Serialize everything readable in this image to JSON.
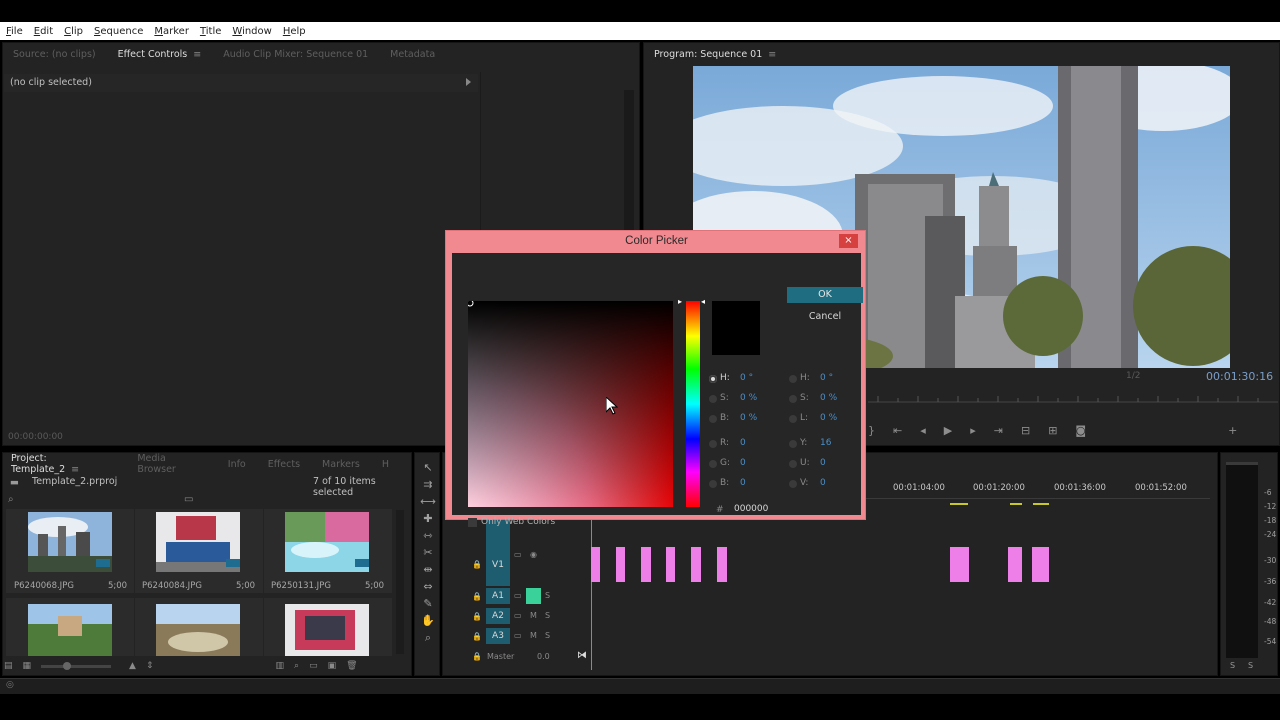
{
  "menu": [
    "File",
    "Edit",
    "Clip",
    "Sequence",
    "Marker",
    "Title",
    "Window",
    "Help"
  ],
  "effect_panel": {
    "tabs": [
      "Source: (no clips)",
      "Effect Controls",
      "Audio Clip Mixer: Sequence 01",
      "Metadata"
    ],
    "no_clip": "(no clip selected)",
    "timecode": "00:00:00:00"
  },
  "program": {
    "title": "Program: Sequence 01",
    "zoom": "1/2",
    "timecode": "00:01:30:16"
  },
  "project": {
    "tabs": [
      "Project: Template_2",
      "Media Browser",
      "Info",
      "Effects",
      "Markers",
      "H"
    ],
    "file": "Template_2.prproj",
    "selection": "7 of 10 items selected",
    "items": [
      {
        "name": "P6240068.JPG",
        "duration": "5;00"
      },
      {
        "name": "P6240084.JPG",
        "duration": "5;00"
      },
      {
        "name": "P6250131.JPG",
        "duration": "5;00"
      },
      {
        "name": "",
        "duration": ""
      },
      {
        "name": "",
        "duration": ""
      },
      {
        "name": "",
        "duration": ""
      }
    ]
  },
  "timeline": {
    "timecodes": [
      "00:01:04:00",
      "00:01:20:00",
      "00:01:36:00",
      "00:01:52:00"
    ],
    "tracks": [
      "V1",
      "A1",
      "A2",
      "A3"
    ],
    "master": {
      "label": "Master",
      "value": "0.0"
    },
    "track_buttons": {
      "m": "M",
      "s": "S"
    }
  },
  "meter": {
    "scale": [
      "-6",
      "-12",
      "-18",
      "-24",
      "-30",
      "-36",
      "-42",
      "-48",
      "-54"
    ],
    "bottom": [
      "S",
      "S"
    ]
  },
  "color_picker": {
    "title": "Color Picker",
    "close": "×",
    "ok": "OK",
    "cancel": "Cancel",
    "hsb": [
      {
        "label": "H:",
        "value": "0 °"
      },
      {
        "label": "S:",
        "value": "0 %"
      },
      {
        "label": "B:",
        "value": "0 %"
      }
    ],
    "rgb": [
      {
        "label": "R:",
        "value": "0"
      },
      {
        "label": "G:",
        "value": "0"
      },
      {
        "label": "B:",
        "value": "0"
      }
    ],
    "hsl": [
      {
        "label": "H:",
        "value": "0 °"
      },
      {
        "label": "S:",
        "value": "0 %"
      },
      {
        "label": "L:",
        "value": "0 %"
      }
    ],
    "yuv": [
      {
        "label": "Y:",
        "value": "16"
      },
      {
        "label": "U:",
        "value": "0"
      },
      {
        "label": "V:",
        "value": "0"
      }
    ],
    "hash": "#",
    "hex": "000000",
    "web_colors": "Only Web Colors"
  }
}
